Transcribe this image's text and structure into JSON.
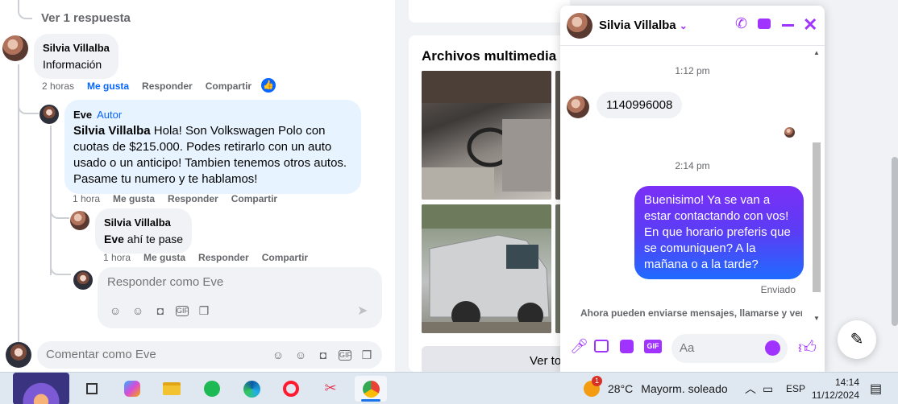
{
  "comments": {
    "view_replies": "Ver 1 respuesta",
    "c1": {
      "author": "Silvia Villalba",
      "text": "Información",
      "time": "2 horas",
      "like": "Me gusta",
      "reply": "Responder",
      "share": "Compartir"
    },
    "c2": {
      "author": "Eve",
      "badge": "Autor",
      "mention": "Silvia Villalba",
      "text": " Hola! Son Volkswagen Polo con cuotas de $215.000. Podes retirarlo con un auto usado o un anticipo! Tambien tenemos otros autos. Pasame tu numero y te hablamos!",
      "time": "1 hora",
      "like": "Me gusta",
      "reply": "Responder",
      "share": "Compartir"
    },
    "c3": {
      "author": "Silvia Villalba",
      "mention": "Eve",
      "text": " ahí te pase",
      "time": "1 hora",
      "like": "Me gusta",
      "reply": "Responder",
      "share": "Compartir"
    },
    "reply_placeholder": "Responder como Eve",
    "comment_placeholder": "Comentar como Eve"
  },
  "media": {
    "title": "Archivos multimedia re",
    "view_all": "Ver to"
  },
  "chat": {
    "name": "Silvia Villalba",
    "ts1": "1:12 pm",
    "msg_in": "1140996008",
    "ts2": "2:14 pm",
    "msg_out": "Buenisimo! Ya se van a estar contactando con vos! En que horario preferis que se comuniquen? A la mañana o a la tarde?",
    "status": "Enviado",
    "notice": "Ahora pueden enviarse mensajes, llamarse y ver",
    "input_placeholder": "Aa",
    "accent": "#a033ff"
  },
  "taskbar": {
    "weather_temp": "28°C",
    "weather_desc": "Mayorm. soleado",
    "weather_badge": "1",
    "lang": "ESP",
    "time": "14:14",
    "date": "11/12/2024",
    "apps": [
      "desktop-wallpaper",
      "task-view",
      "copilot",
      "file-explorer",
      "spotify",
      "edge",
      "opera",
      "snipping-tool",
      "chrome"
    ]
  }
}
